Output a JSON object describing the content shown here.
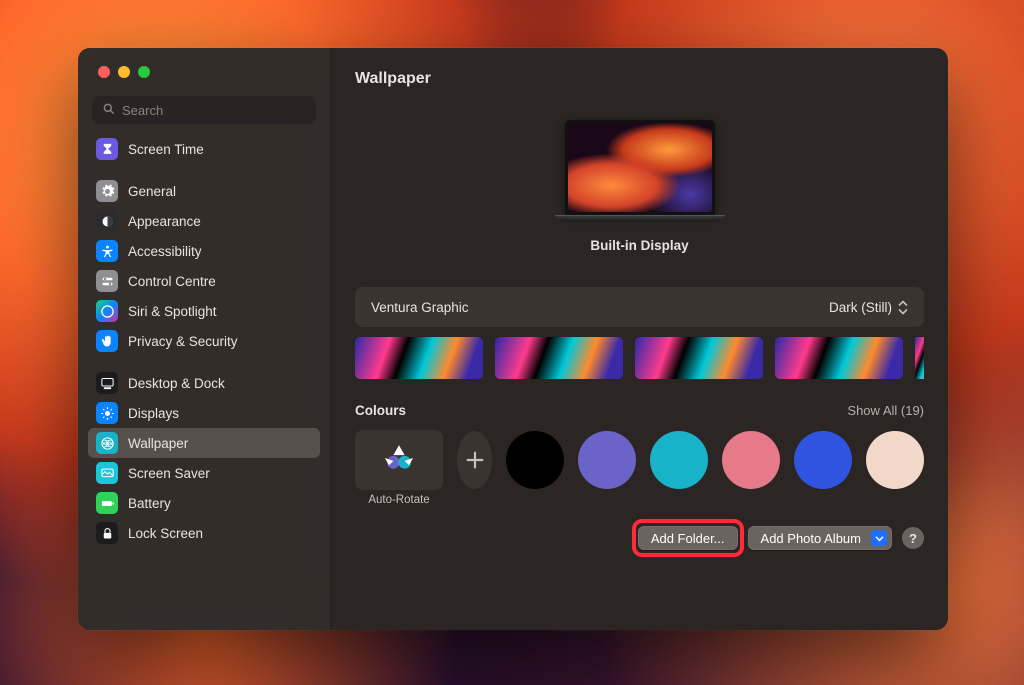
{
  "window": {
    "title": "Wallpaper"
  },
  "search": {
    "placeholder": "Search"
  },
  "sidebar": {
    "items": [
      {
        "label": "Screen Time",
        "icon": "hourglass-icon",
        "bg": "#6a5ae0"
      },
      {
        "label": "General",
        "icon": "gear-icon",
        "bg": "#8e8e93"
      },
      {
        "label": "Appearance",
        "icon": "appearance-icon",
        "bg": "#2c2c2e"
      },
      {
        "label": "Accessibility",
        "icon": "accessibility-icon",
        "bg": "#0a84ff"
      },
      {
        "label": "Control Centre",
        "icon": "control-centre-icon",
        "bg": "#8e8e93"
      },
      {
        "label": "Siri & Spotlight",
        "icon": "siri-icon",
        "bg": "linear-gradient(135deg,#21d07a,#0a84ff,#d72ea8)"
      },
      {
        "label": "Privacy & Security",
        "icon": "hand-icon",
        "bg": "#0a84ff"
      },
      {
        "label": "Desktop & Dock",
        "icon": "dock-icon",
        "bg": "#1c1c1e"
      },
      {
        "label": "Displays",
        "icon": "displays-icon",
        "bg": "#0a84ff"
      },
      {
        "label": "Wallpaper",
        "icon": "wallpaper-icon",
        "bg": "#18b3c8",
        "selected": true
      },
      {
        "label": "Screen Saver",
        "icon": "screensaver-icon",
        "bg": "#18c8d8"
      },
      {
        "label": "Battery",
        "icon": "battery-icon",
        "bg": "#30d158"
      },
      {
        "label": "Lock Screen",
        "icon": "lock-icon",
        "bg": "#1c1c1e"
      }
    ]
  },
  "preview": {
    "display_label": "Built-in Display"
  },
  "current": {
    "name": "Ventura Graphic",
    "mode": "Dark (Still)"
  },
  "colours": {
    "title": "Colours",
    "show_all_label": "Show All (19)",
    "auto_rotate_label": "Auto-Rotate",
    "swatches": [
      "#000000",
      "#6b63c8",
      "#18b3c8",
      "#e67a88",
      "#2f55e0",
      "#f2d8c8"
    ]
  },
  "footer": {
    "add_folder": "Add Folder...",
    "add_photo_album": "Add Photo Album",
    "help": "?"
  }
}
